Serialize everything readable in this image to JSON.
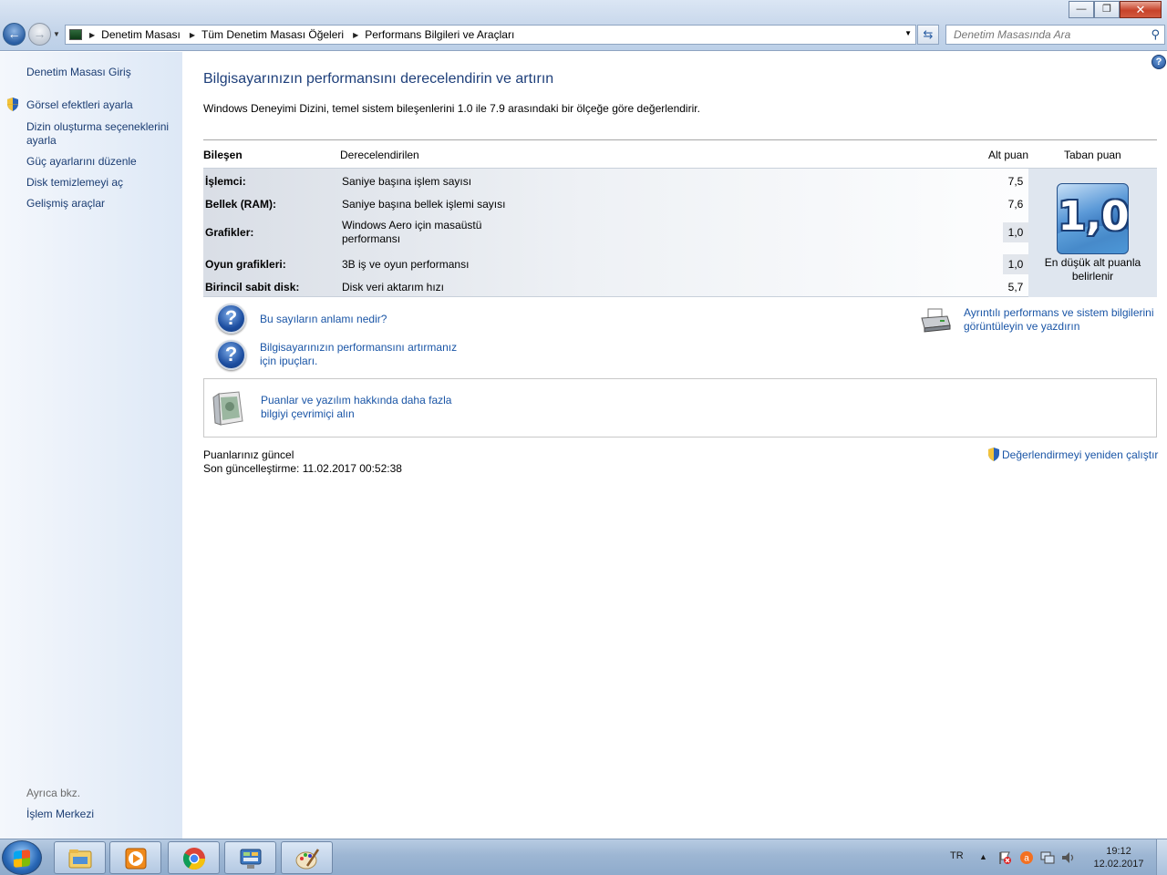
{
  "window": {
    "minimize_label": "—",
    "maximize_label": "❐",
    "close_label": "✕"
  },
  "address_bar": {
    "crumbs": [
      "Denetim Masası",
      "Tüm Denetim Masası Öğeleri",
      "Performans Bilgileri ve Araçları"
    ],
    "search_placeholder": "Denetim Masasında Ara"
  },
  "sidebar": {
    "home": "Denetim Masası Giriş",
    "items": [
      "Görsel efektleri ayarla",
      "Dizin oluşturma seçeneklerini ayarla",
      "Güç ayarlarını düzenle",
      "Disk temizlemeyi aç",
      "Gelişmiş araçlar"
    ],
    "see_also_label": "Ayrıca bkz.",
    "see_also_items": [
      "İşlem Merkezi"
    ]
  },
  "main": {
    "title": "Bilgisayarınızın performansını derecelendirin ve artırın",
    "description": "Windows Deneyimi Dizini, temel sistem bileşenlerini 1.0 ile 7.9 arasındaki bir ölçeğe göre değerlendirir.",
    "table": {
      "headers": {
        "component": "Bileşen",
        "rated": "Derecelendirilen",
        "subscore": "Alt puan",
        "base": "Taban puan"
      },
      "rows": [
        {
          "component": "İşlemci:",
          "description": "Saniye başına işlem sayısı",
          "score": "7,5"
        },
        {
          "component": "Bellek (RAM):",
          "description": "Saniye başına bellek işlemi sayısı",
          "score": "7,6"
        },
        {
          "component": "Grafikler:",
          "description": "Windows Aero için masaüstü performansı",
          "score": "1,0"
        },
        {
          "component": "Oyun grafikleri:",
          "description": "3B iş ve oyun performansı",
          "score": "1,0"
        },
        {
          "component": "Birincil sabit disk:",
          "description": "Disk veri aktarım hızı",
          "score": "5,7"
        }
      ],
      "base_score": "1,0",
      "base_caption": "En düşük alt puanla belirlenir"
    },
    "links": {
      "meaning": "Bu sayıların anlamı nedir?",
      "tips": "Bilgisayarınızın performansını artırmanız için ipuçları.",
      "details": "Ayrıntılı performans ve sistem bilgilerini görüntüleyin ve yazdırın",
      "online": "Puanlar ve yazılım hakkında daha fazla bilgiyi çevrimiçi alın",
      "rerun": "Değerlendirmeyi yeniden çalıştır"
    },
    "status": {
      "line1": "Puanlarınız güncel",
      "line2": "Son güncelleştirme: 11.02.2017 00:52:38"
    }
  },
  "taskbar": {
    "pinned": [
      "explorer-icon",
      "media-player-icon",
      "chrome-icon",
      "control-panel-icon",
      "paint-icon"
    ],
    "language": "TR",
    "time": "19:12",
    "date": "12.02.2017"
  },
  "colors": {
    "link": "#1a55a6",
    "title": "#1e3f7a",
    "sidebar_link": "#1a3c72"
  }
}
